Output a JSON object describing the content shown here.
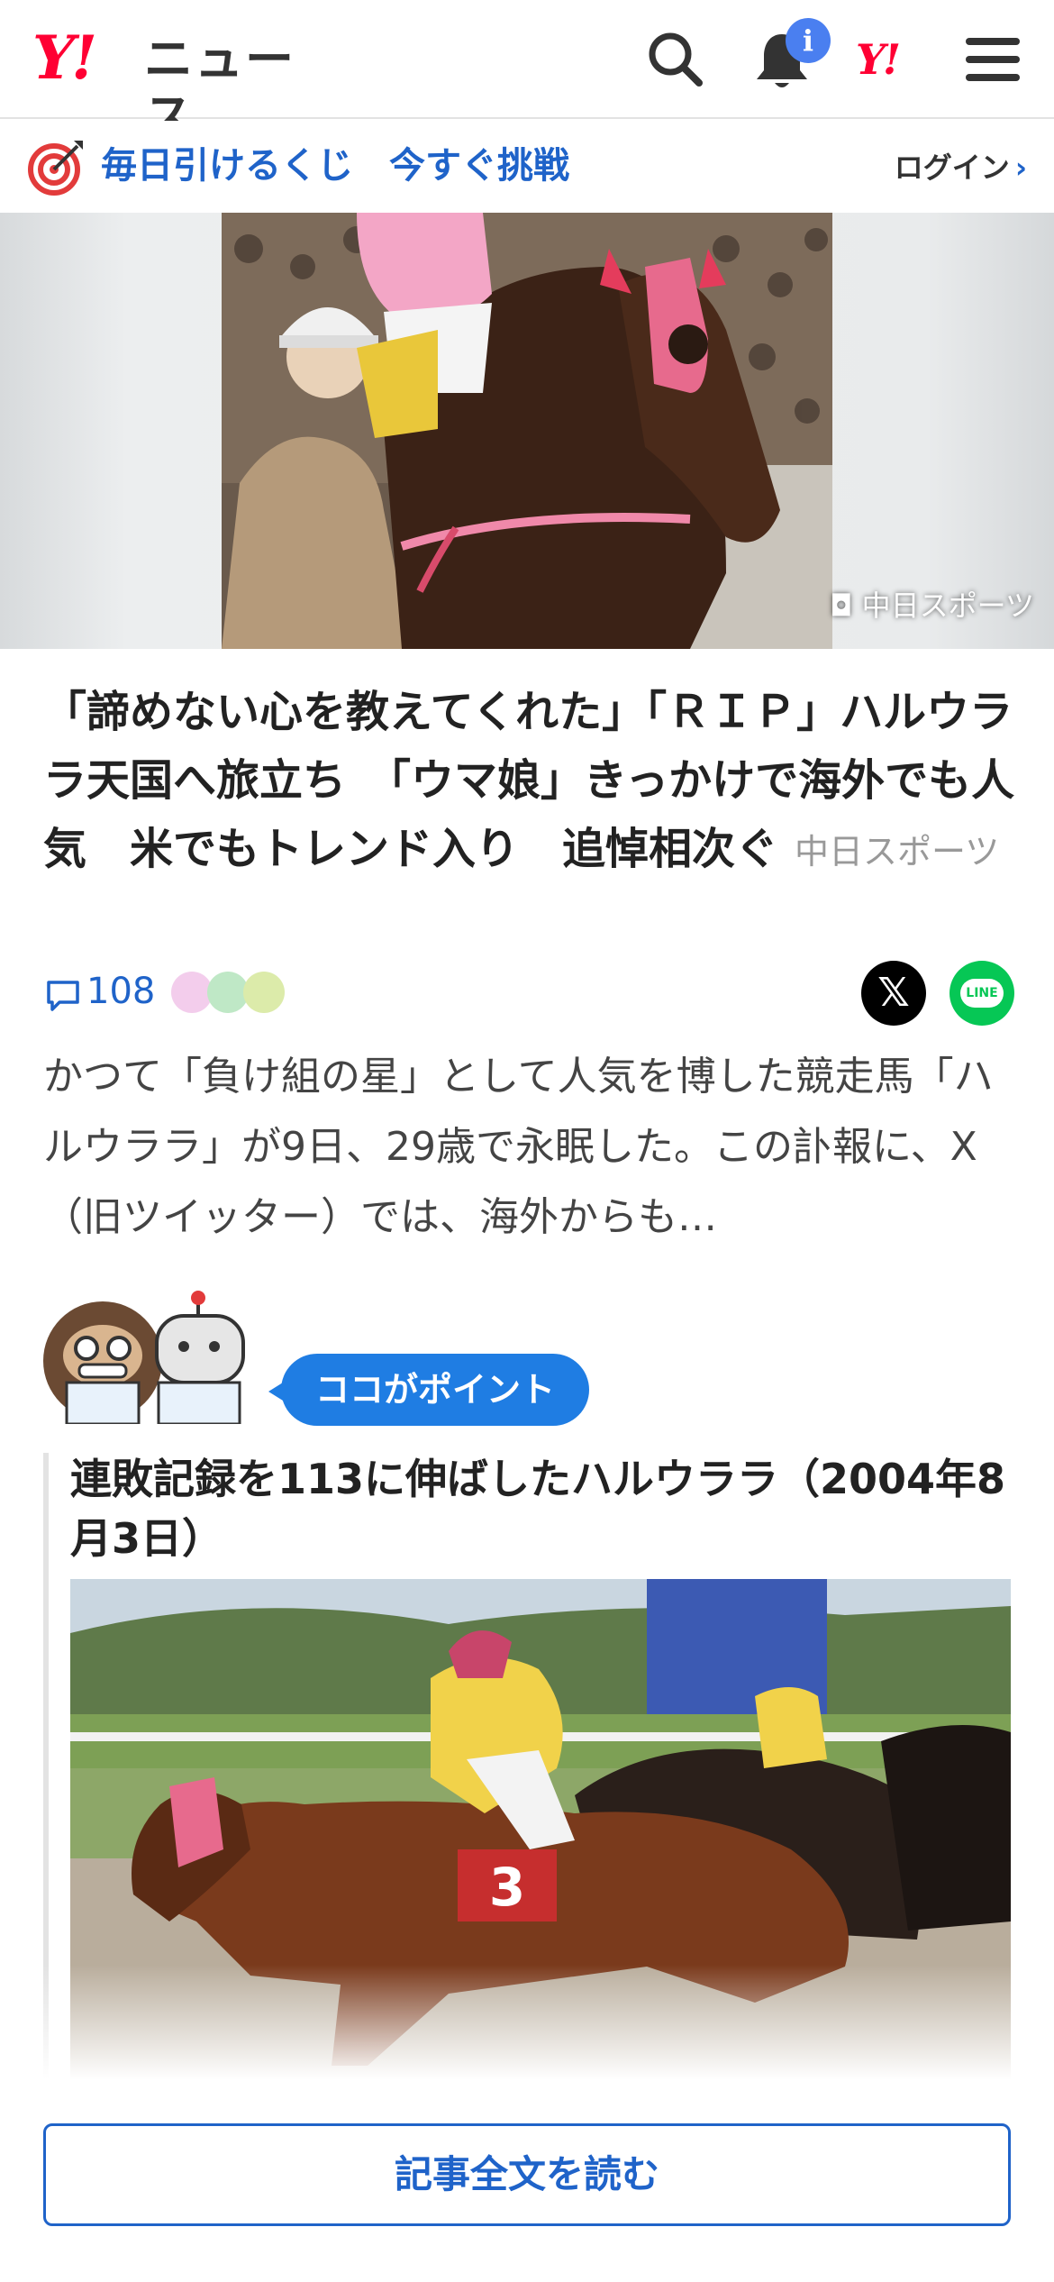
{
  "header": {
    "logo_mark": "Y!",
    "logo_text": "ニュース",
    "notification_badge": "i",
    "yahoo_mark": "Y!",
    "icons": [
      "search-icon",
      "bell-icon",
      "yahoo-japan-icon",
      "menu-icon"
    ]
  },
  "promo": {
    "text": "毎日引けるくじ　今すぐ挑戦",
    "login": "ログイン",
    "login_chevron": "›"
  },
  "hero": {
    "credit": "中日スポーツ"
  },
  "article": {
    "headline": "「諦めない心を教えてくれた」「ＲＩＰ」ハルウララ天国へ旅立ち　「ウマ娘」きっかけで海外でも人気　米でもトレンド入り　追悼相次ぐ",
    "source": "中日スポーツ",
    "comment_count": "108",
    "share_x": "𝕏",
    "share_line": "LINE",
    "summary": "かつて「負け組の星」として人気を博した競走馬「ハルウララ」が9日、29歳で永眠した。この訃報に、X（旧ツイッター）では、海外からも…"
  },
  "point": {
    "badge": "ココがポイント",
    "title": "連敗記録を113に伸ばしたハルウララ（2004年8月3日）",
    "saddle_number": "3"
  },
  "actions": {
    "read_full": "記事全文を読む"
  },
  "colors": {
    "brand_red": "#ff0033",
    "link_blue": "#1f63c9",
    "badge_blue": "#1f7de3",
    "line_green": "#06c755"
  }
}
